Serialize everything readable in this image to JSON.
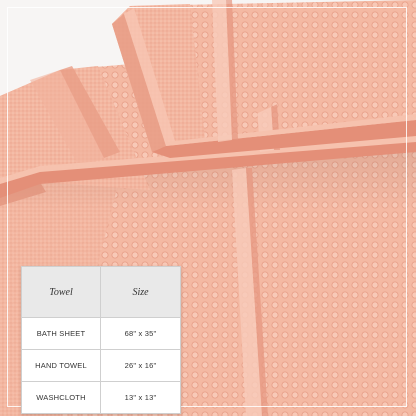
{
  "image": {
    "subject": "peach-towels-stacked",
    "colors": {
      "towel": "#f4b9a3",
      "towel_shadow": "#e89d86",
      "towel_light": "#f8cbb9",
      "background": "#f7f5f4",
      "table_header_bg": "#e9e9e9",
      "table_border": "#cfcfcf",
      "frame": "#ffffff"
    }
  },
  "size_table": {
    "headers": {
      "towel": "Towel",
      "size": "Size"
    },
    "rows": [
      {
        "name": "BATH SHEET",
        "size": "68\" x 35\""
      },
      {
        "name": "HAND TOWEL",
        "size": "26\" x 16\""
      },
      {
        "name": "WASHCLOTH",
        "size": "13\" x 13\""
      }
    ]
  }
}
